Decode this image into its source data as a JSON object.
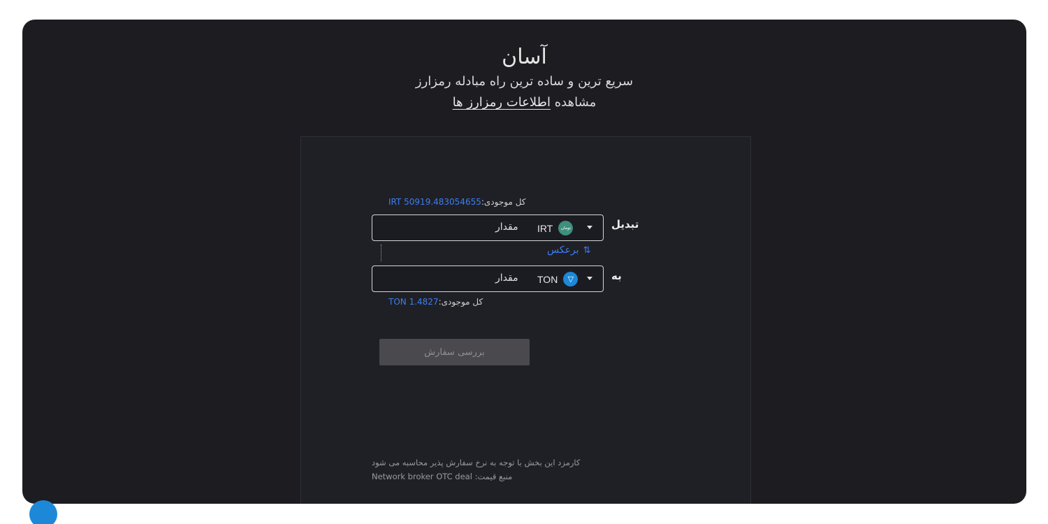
{
  "hero": {
    "title": "آسان",
    "subtitle": "سریع ترین و ساده ترین راه مبادله رمزارز",
    "link_prefix": "مشاهده",
    "link_text": "اطلاعات رمزارز ها"
  },
  "exchange": {
    "from": {
      "label": "تبدیل",
      "balance_label": "کل موجودی:",
      "balance_value": "IRT 50919.483054655",
      "coin": "IRT",
      "coin_icon_text": "تومان",
      "icon": "toman-icon",
      "amount_placeholder": "مقدار"
    },
    "swap_label": "برعکس",
    "swap_icon": "swap-arrows-icon",
    "to": {
      "label": "به",
      "balance_label": "کل موجودی:",
      "balance_value": "TON 1.4827",
      "coin": "TON",
      "icon": "ton-icon",
      "amount_placeholder": "مقدار"
    },
    "submit_label": "بررسی سفارش"
  },
  "notes": {
    "fee": "کارمزد این بخش با توجه به نرخ سفارش پذیر محاسبه می شود",
    "source_label": "منبع قیمت:",
    "source_value": "Network broker OTC deal"
  },
  "colors": {
    "background": "#1c1c21",
    "card": "#1f2025",
    "accent": "#3d7df2",
    "toman": "#3e8f7c",
    "ton": "#1e88d8"
  }
}
